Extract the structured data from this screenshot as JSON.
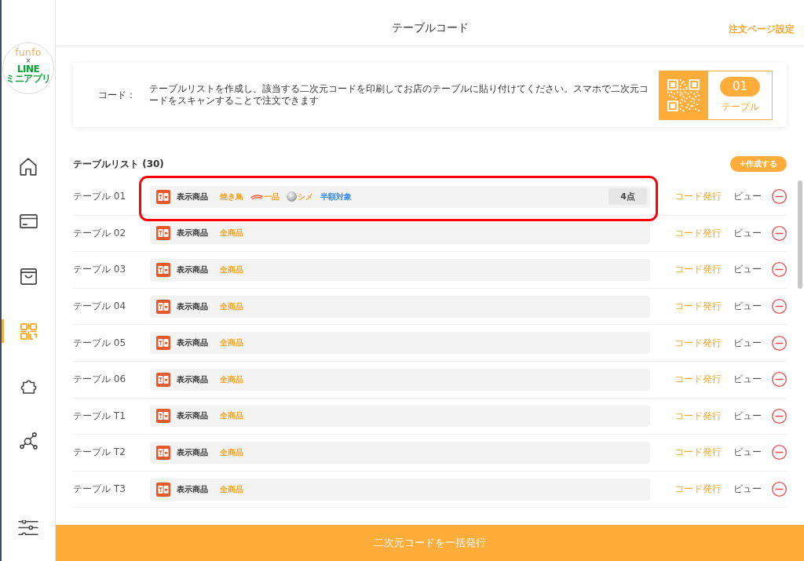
{
  "sidebar": {
    "logo": {
      "brand": "funfo",
      "separator": "×",
      "partner": "LINE ミニアプリ"
    },
    "items": [
      {
        "selected": false
      },
      {
        "selected": false
      },
      {
        "selected": false
      },
      {
        "selected": true
      },
      {
        "selected": false
      },
      {
        "selected": false
      }
    ]
  },
  "header": {
    "title": "テーブルコード",
    "link": "注文ページ設定"
  },
  "code_card": {
    "label": "コード：",
    "description": "テーブルリストを作成し、該当する二次元コードを印刷してお店のテーブルに貼り付けてください。スマホで二次元コードをスキャンすることで注文できます",
    "table_number": "01",
    "table_caption": "テーブル"
  },
  "table_list": {
    "title": "テーブルリスト (30)",
    "create_button": "+作成する",
    "rows": [
      {
        "name": "テーブル 01",
        "highlighted": true,
        "product_label": "表示商品",
        "tags": [
          {
            "text": "焼き鳥",
            "kind": "plain",
            "color": "#f7a423"
          },
          {
            "text": "一品",
            "kind": "sushi",
            "color": "#f7a423"
          },
          {
            "text": "シメ",
            "kind": "ball",
            "color": "#f7a423"
          },
          {
            "text": "半額対象",
            "kind": "plain",
            "color": "#3d8ef0"
          }
        ],
        "count": "4点",
        "issue_link": "コード発行",
        "view_link": "ビュー"
      },
      {
        "name": "テーブル 02",
        "product_label": "表示商品",
        "tags": [
          {
            "text": "全商品",
            "kind": "plain",
            "color": "#f7a423"
          }
        ],
        "issue_link": "コード発行",
        "view_link": "ビュー"
      },
      {
        "name": "テーブル 03",
        "product_label": "表示商品",
        "tags": [
          {
            "text": "全商品",
            "kind": "plain",
            "color": "#f7a423"
          }
        ],
        "issue_link": "コード発行",
        "view_link": "ビュー"
      },
      {
        "name": "テーブル 04",
        "product_label": "表示商品",
        "tags": [
          {
            "text": "全商品",
            "kind": "plain",
            "color": "#f7a423"
          }
        ],
        "issue_link": "コード発行",
        "view_link": "ビュー"
      },
      {
        "name": "テーブル 05",
        "product_label": "表示商品",
        "tags": [
          {
            "text": "全商品",
            "kind": "plain",
            "color": "#f7a423"
          }
        ],
        "issue_link": "コード発行",
        "view_link": "ビュー"
      },
      {
        "name": "テーブル 06",
        "product_label": "表示商品",
        "tags": [
          {
            "text": "全商品",
            "kind": "plain",
            "color": "#f7a423"
          }
        ],
        "issue_link": "コード発行",
        "view_link": "ビュー"
      },
      {
        "name": "テーブル T1",
        "product_label": "表示商品",
        "tags": [
          {
            "text": "全商品",
            "kind": "plain",
            "color": "#f7a423"
          }
        ],
        "issue_link": "コード発行",
        "view_link": "ビュー"
      },
      {
        "name": "テーブル T2",
        "product_label": "表示商品",
        "tags": [
          {
            "text": "全商品",
            "kind": "plain",
            "color": "#f7a423"
          }
        ],
        "issue_link": "コード発行",
        "view_link": "ビュー"
      },
      {
        "name": "テーブル T3",
        "product_label": "表示商品",
        "tags": [
          {
            "text": "全商品",
            "kind": "plain",
            "color": "#f7a423"
          }
        ],
        "issue_link": "コード発行",
        "view_link": "ビュー"
      }
    ]
  },
  "bulk_button": "二次元コードを一括発行"
}
